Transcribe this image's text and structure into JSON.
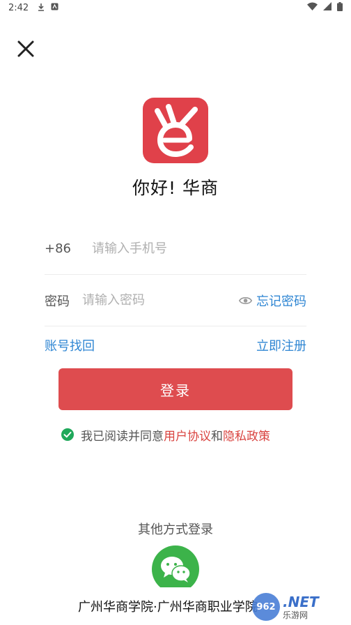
{
  "status_bar": {
    "time": "2:42"
  },
  "greeting": "你好! 华商",
  "phone": {
    "prefix": "+86",
    "placeholder": "请输入手机号"
  },
  "password": {
    "label": "密码",
    "placeholder": "请输入密码",
    "forgot": "忘记密码"
  },
  "links": {
    "account_recovery": "账号找回",
    "register": "立即注册"
  },
  "login_button": "登录",
  "agreement": {
    "prefix": "我已阅读并同意",
    "user_agreement": "用户协议",
    "and": "和",
    "privacy_policy": "隐私政策",
    "checked": true
  },
  "other_login": {
    "title": "其他方式登录",
    "wechat": "wechat-icon"
  },
  "footer_text": "广州华商学院·广州华商职业学院",
  "watermark": {
    "number": "962",
    "net": ".NET",
    "sub": "乐游网"
  },
  "colors": {
    "brand_red": "#de4c4f",
    "logo_red": "#e0414a",
    "link_blue": "#2f86d3",
    "policy_red": "#d9433f",
    "wechat_green": "#3cb34a"
  }
}
